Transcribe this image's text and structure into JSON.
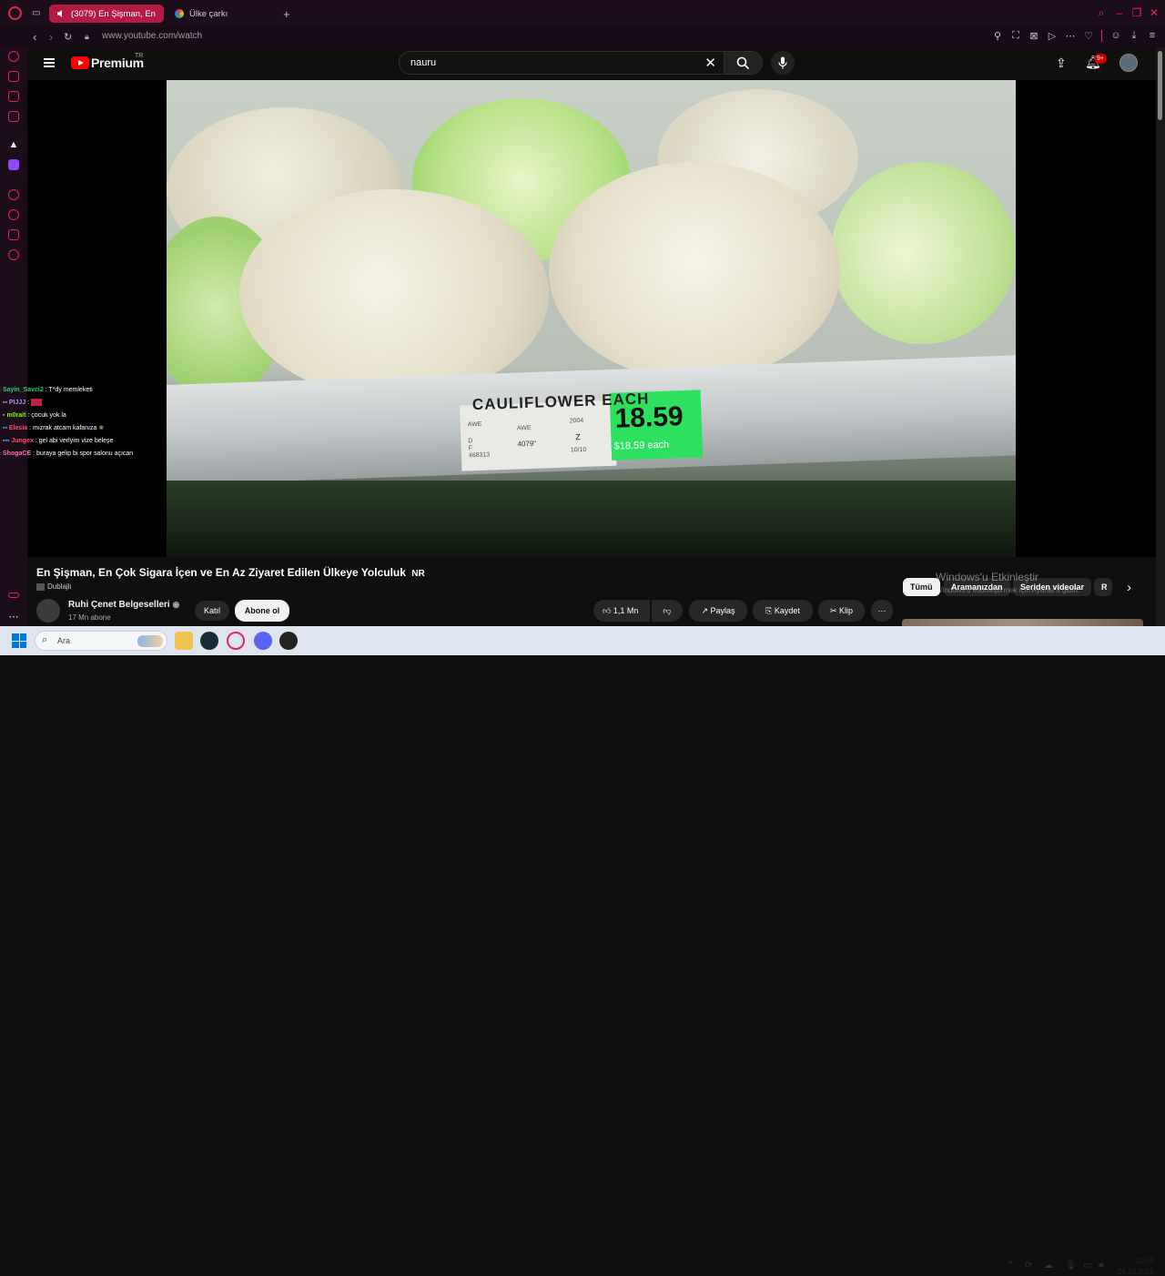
{
  "browser": {
    "tabs": [
      {
        "label": "(3079) En Şişman, En",
        "active": true
      },
      {
        "label": "Ülke çarkı",
        "active": false
      }
    ],
    "url": "www.youtube.com/watch"
  },
  "youtube": {
    "logo_text": "Premium",
    "logo_region": "TR",
    "search_value": "nauru",
    "notification_count": "9+"
  },
  "video_frame": {
    "tag_title": "CAULIFLOWER EACH",
    "tag_price": "18.59",
    "tag_each": "$18.59 each",
    "tag_code_1": "AWE",
    "tag_code_2": "AWE",
    "tag_code_3": "4079\"",
    "tag_code_4": "468313",
    "tag_code_5": "2004",
    "tag_code_6": "Z",
    "tag_code_7": "10/10",
    "tag_code_8": "D",
    "tag_code_9": "F"
  },
  "chat": [
    {
      "user": "Sayin_Savci2",
      "text": ": T*dy memleketi",
      "color": "#2ecc71"
    },
    {
      "user": "PIJJJ",
      "text": ":",
      "color": "#b58cff"
    },
    {
      "user": "m0rait",
      "text": ": çocuk yok la",
      "color": "#7cfc00"
    },
    {
      "user": "Elesia",
      "text": ": mızrak atcam kafanıza",
      "color": "#ff4d6d"
    },
    {
      "user": "Jungex",
      "text": ": gel abi verlyim vize beleşe",
      "color": "#ff4d6d"
    },
    {
      "user": "ShogaCE",
      "text": ": buraya gelip bi spor salonu açıcan",
      "color": "#ff6fa8"
    }
  ],
  "video_info": {
    "title": "En Şişman, En Çok Sigara İçen ve En Az Ziyaret Edilen Ülkeye Yolculuk",
    "title_badge": "NR",
    "dubbed": "Dublajlı",
    "channel": "Ruhi Çenet Belgeselleri",
    "subscribers": "17 Mn abone",
    "join": "Katıl",
    "subscribe": "Abone ol",
    "likes": "1,1 Mn",
    "share": "Paylaş",
    "save": "Kaydet",
    "clip": "Klip"
  },
  "chips": [
    "Tümü",
    "Aramanızdan",
    "Seriden videolar",
    "R"
  ],
  "watermark": {
    "line1": "Windows'u Etkinleştir",
    "line2": "Windows'u etkinleştirmek için Ayarlar'a gidin."
  },
  "taskbar": {
    "search_placeholder": "Ara",
    "time": "21:59",
    "date": "26.12.2025"
  }
}
